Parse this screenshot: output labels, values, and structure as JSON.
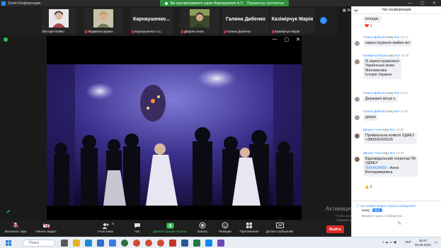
{
  "window": {
    "title": "Zoom Конференция",
    "share_banner": "Вы просматриваете экран Карнаушенко А.С.",
    "share_options": "Параметры просмотра"
  },
  "strip": {
    "tiles": [
      {
        "name": "Вікторія Бойко",
        "muted": false
      },
      {
        "name": "Людмила Шумко",
        "muted": true
      },
      {
        "big": "Карнаушенко...",
        "name": "Карнаушенко А.С.",
        "muted": true
      },
      {
        "name": "Дворна Анна",
        "muted": true
      },
      {
        "big": "Галина Дибенко",
        "name": "Галина Дибенко",
        "muted": true
      },
      {
        "big": "Казімірчук Марія",
        "name": "Казімірчук Марія",
        "muted": true
      }
    ],
    "view_label": "Вид"
  },
  "toolbar": {
    "unmute": "Включить звук",
    "video": "Начать видео",
    "participants": "Участники",
    "participants_count": "5",
    "chat": "Чат",
    "share": "Демонстрация экрана",
    "record": "Запись",
    "reactions": "Реакции",
    "apps": "Приложения",
    "whiteboards": "Доски сообщений",
    "leave": "Выйти"
  },
  "watermark": {
    "title": "Активация W",
    "line1": "Чтобы активировать Windows, перейдите в раздел",
    "line2": "\"Параметры\"."
  },
  "chat": {
    "title": "Чат конференции",
    "top_text": "коледж.",
    "reaction": "❤️ 1",
    "messages": [
      {
        "from": "Галина Дибенко",
        "to": "Все",
        "time": "15:19",
        "lines": [
          "зареєстрували майже всі"
        ]
      },
      {
        "from": "Казімірчук Марія",
        "to": "Все",
        "time": "15:20",
        "lines": [
          "Я зареєструвалася",
          "Українська мова",
          "Математика",
          "Історія України"
        ]
      },
      {
        "from": "Галина Дибенко",
        "to": "Все",
        "time": "15:21",
        "lines": [
          "Державні місця є"
        ]
      },
      {
        "from": "Галина Дибенко",
        "to": "Все",
        "time": "15:26",
        "lines": [
          "дякую"
        ]
      },
      {
        "from": "Дворна Анна",
        "to": "Все",
        "time": "15:30",
        "lines": [
          "Приймальна комісія ХДАЕУ",
          "+380930426526"
        ]
      },
      {
        "from": "Дворна Анна",
        "to": "Все",
        "time": "15:30",
        "lines": [
          "Відповідальний секретар ПК",
          "ХДАЕУ",
          "0500424089 - Анна",
          "Володимирівна"
        ],
        "link": "0500424089"
      }
    ],
    "bottom_reaction": "👍 2",
    "to_word": "кому",
    "who_can_see": "Кто может видеть ваши сообщения?",
    "to_label": "Кому:",
    "to_value": "Все",
    "input_placeholder": "Введите здесь сообщение..."
  },
  "taskbar": {
    "search": "Поиск",
    "lang": "УКР",
    "time": "15:37",
    "date": "03.05.2023"
  }
}
